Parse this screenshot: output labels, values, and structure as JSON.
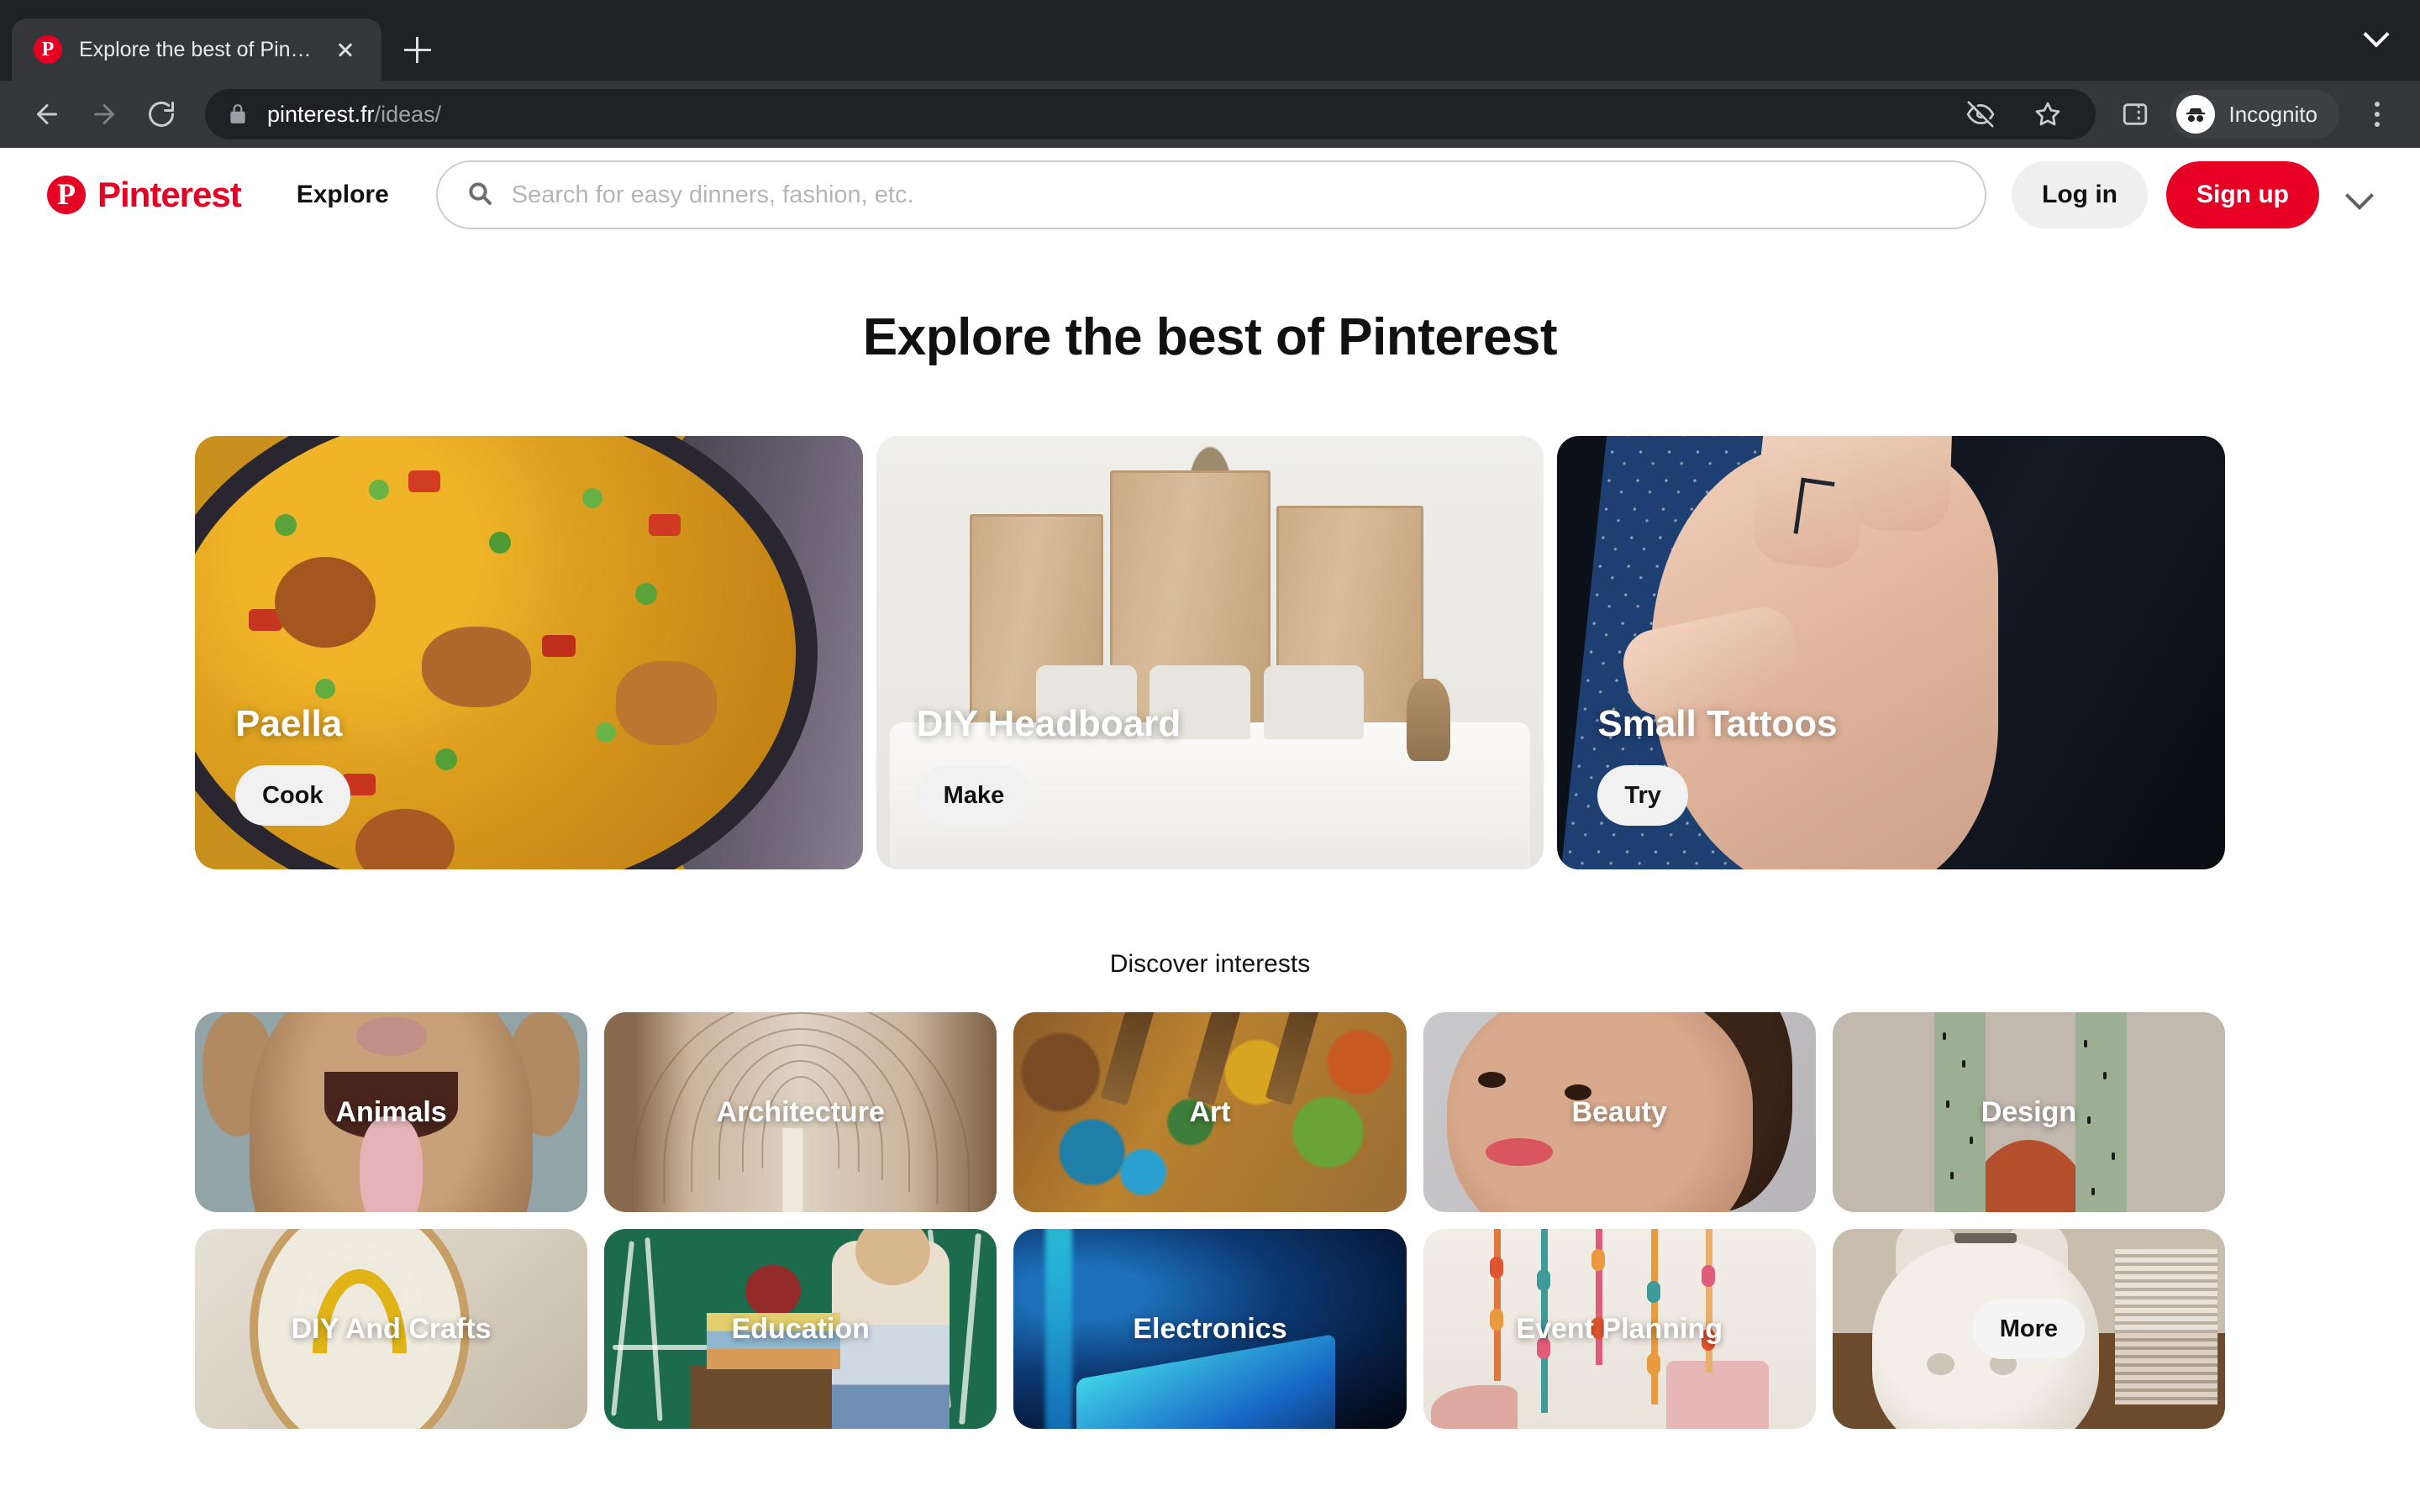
{
  "browser": {
    "tab": {
      "title": "Explore the best of Pinterest",
      "favicon": "pinterest-favicon",
      "close": "close-icon"
    },
    "new_tab_label": "new-tab-icon",
    "tab_list_chevron": "chevron-down-icon",
    "nav": {
      "back": "back-arrow-icon",
      "forward": "forward-arrow-icon",
      "reload": "reload-icon"
    },
    "omnibox": {
      "lock": "lock-icon",
      "domain": "pinterest.fr",
      "path": "/ideas/"
    },
    "actions": {
      "cookies_blocked": "eye-slash-icon",
      "bookmark": "star-icon",
      "side_panel": "side-panel-icon",
      "profile_label": "Incognito",
      "menu": "kebab-menu-icon"
    }
  },
  "header": {
    "logo_word": "Pinterest",
    "logo_mark": "P",
    "explore_label": "Explore",
    "search": {
      "icon": "search-icon",
      "placeholder": "Search for easy dinners, fashion, etc.",
      "value": ""
    },
    "login_label": "Log in",
    "signup_label": "Sign up",
    "chevron": "chevron-down-icon"
  },
  "main": {
    "title": "Explore the best of Pinterest",
    "cards": [
      {
        "label": "Paella",
        "action": "Cook",
        "art": "paella"
      },
      {
        "label": "DIY Headboard",
        "action": "Make",
        "art": "headboard"
      },
      {
        "label": "Small Tattoos",
        "action": "Try",
        "art": "tattoo"
      }
    ],
    "discover_title": "Discover interests",
    "interests": [
      {
        "label": "Animals",
        "art": "animals"
      },
      {
        "label": "Architecture",
        "art": "architecture"
      },
      {
        "label": "Art",
        "art": "art"
      },
      {
        "label": "Beauty",
        "art": "beauty"
      },
      {
        "label": "Design",
        "art": "design"
      },
      {
        "label": "DIY And Crafts",
        "art": "diy"
      },
      {
        "label": "Education",
        "art": "education"
      },
      {
        "label": "Electronics",
        "art": "electronics"
      },
      {
        "label": "Event Planning",
        "art": "event"
      },
      {
        "label": "",
        "action": "More",
        "art": "piggy"
      }
    ]
  },
  "colors": {
    "brand_red": "#e60023",
    "chrome_dark": "#202124",
    "chrome_toolbar": "#35363a",
    "page_bg": "#ffffff",
    "pill_bg": "#f1f1f1"
  }
}
